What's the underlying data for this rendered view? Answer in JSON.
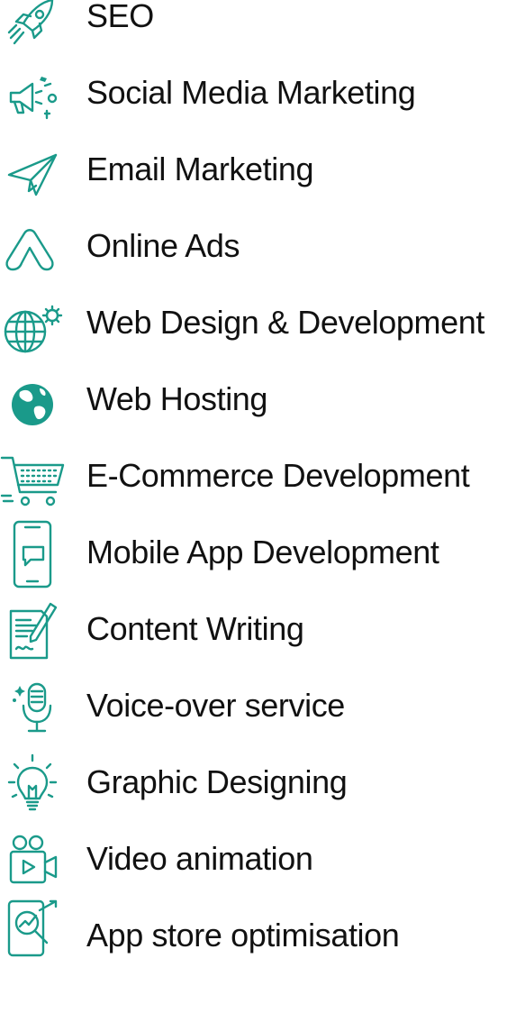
{
  "accent_color": "#1a9a8a",
  "services": [
    {
      "label": "SEO",
      "icon": "rocket-icon"
    },
    {
      "label": "Social Media Marketing",
      "icon": "megaphone-icon"
    },
    {
      "label": "Email Marketing",
      "icon": "paper-plane-icon"
    },
    {
      "label": "Online Ads",
      "icon": "ads-logo-icon"
    },
    {
      "label": "Web Design & Development",
      "icon": "globe-gear-icon"
    },
    {
      "label": "Web Hosting",
      "icon": "earth-icon"
    },
    {
      "label": "E-Commerce Development",
      "icon": "shopping-cart-icon"
    },
    {
      "label": "Mobile App Development",
      "icon": "mobile-phone-icon"
    },
    {
      "label": "Content Writing",
      "icon": "document-pen-icon"
    },
    {
      "label": "Voice-over service",
      "icon": "microphone-icon"
    },
    {
      "label": "Graphic Designing",
      "icon": "light-bulb-icon"
    },
    {
      "label": "Video animation",
      "icon": "video-camera-icon"
    },
    {
      "label": "App store optimisation",
      "icon": "magnifier-chart-icon"
    }
  ]
}
